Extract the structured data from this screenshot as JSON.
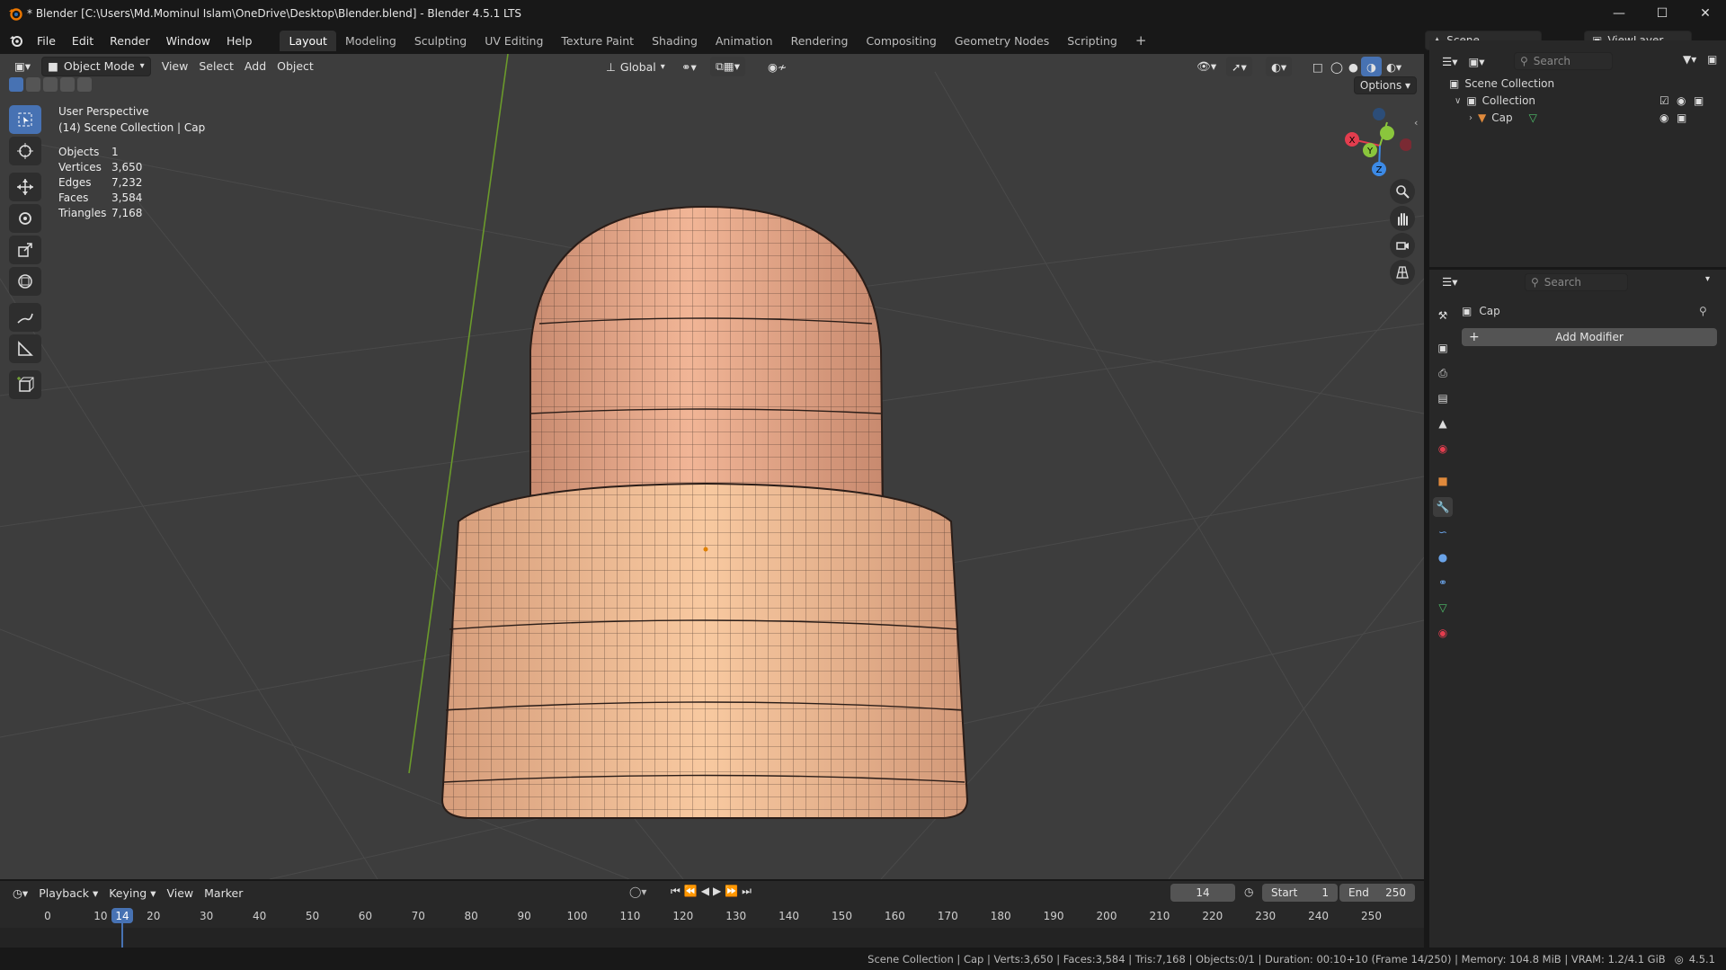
{
  "window": {
    "title": "* Blender [C:\\Users\\Md.Mominul Islam\\OneDrive\\Desktop\\Blender.blend] - Blender 4.5.1 LTS",
    "minimize": "—",
    "maximize": "☐",
    "close": "✕"
  },
  "menu": [
    "File",
    "Edit",
    "Render",
    "Window",
    "Help"
  ],
  "workspaces": {
    "tabs": [
      "Layout",
      "Modeling",
      "Sculpting",
      "UV Editing",
      "Texture Paint",
      "Shading",
      "Animation",
      "Rendering",
      "Compositing",
      "Geometry Nodes",
      "Scripting"
    ],
    "active": "Layout",
    "add": "+"
  },
  "scene": {
    "label": "Scene",
    "view_layer": "ViewLayer"
  },
  "viewport_header": {
    "mode": "Object Mode",
    "menus": [
      "View",
      "Select",
      "Add",
      "Object"
    ],
    "orientation": "Global",
    "options": "Options"
  },
  "overlay": {
    "perspective": "User Perspective",
    "context": "(14) Scene Collection | Cap",
    "stats": [
      {
        "label": "Objects",
        "value": "1"
      },
      {
        "label": "Vertices",
        "value": "3,650"
      },
      {
        "label": "Edges",
        "value": "7,232"
      },
      {
        "label": "Faces",
        "value": "3,584"
      },
      {
        "label": "Triangles",
        "value": "7,168"
      }
    ]
  },
  "gizmo": {
    "x": "X",
    "y": "Y",
    "z": "Z"
  },
  "outliner": {
    "search_placeholder": "Search",
    "items": [
      "Scene Collection",
      "Collection",
      "Cap"
    ]
  },
  "properties": {
    "search_placeholder": "Search",
    "object_name": "Cap",
    "add_modifier": "Add Modifier"
  },
  "timeline": {
    "menus": [
      "Playback",
      "Keying",
      "View",
      "Marker"
    ],
    "current_frame": "14",
    "start_label": "Start",
    "start": "1",
    "end_label": "End",
    "end": "250",
    "ticks": [
      "0",
      "10",
      "20",
      "30",
      "40",
      "50",
      "60",
      "70",
      "80",
      "90",
      "100",
      "110",
      "120",
      "130",
      "140",
      "150",
      "160",
      "170",
      "180",
      "190",
      "200",
      "210",
      "220",
      "230",
      "240",
      "250"
    ]
  },
  "status_bar": {
    "text": "Scene Collection | Cap | Verts:3,650 | Faces:3,584 | Tris:7,168 | Objects:0/1 | Duration: 00:10+10 (Frame 14/250) | Memory: 104.8 MiB | VRAM: 1.2/4.1 GiB",
    "version": "4.5.1"
  },
  "colors": {
    "accent": "#4772b3",
    "viewport_bg": "#3d3d3d",
    "panel_bg": "#282828",
    "model": "#e8a98a",
    "x_axis": "#e33d4e",
    "y_axis": "#8ac63c",
    "z_axis": "#3c8ae6"
  },
  "icons": [
    "blender-logo-icon",
    "select-box-icon",
    "cursor-icon",
    "move-icon",
    "rotate-icon",
    "scale-icon",
    "transform-icon",
    "annotate-icon",
    "measure-icon",
    "add-cube-icon",
    "zoom-icon",
    "hand-icon",
    "camera-icon",
    "grid-icon",
    "eye-icon",
    "camera-restrict-icon",
    "mesh-icon",
    "wrench-icon",
    "filter-icon",
    "search-icon",
    "play-icon"
  ]
}
